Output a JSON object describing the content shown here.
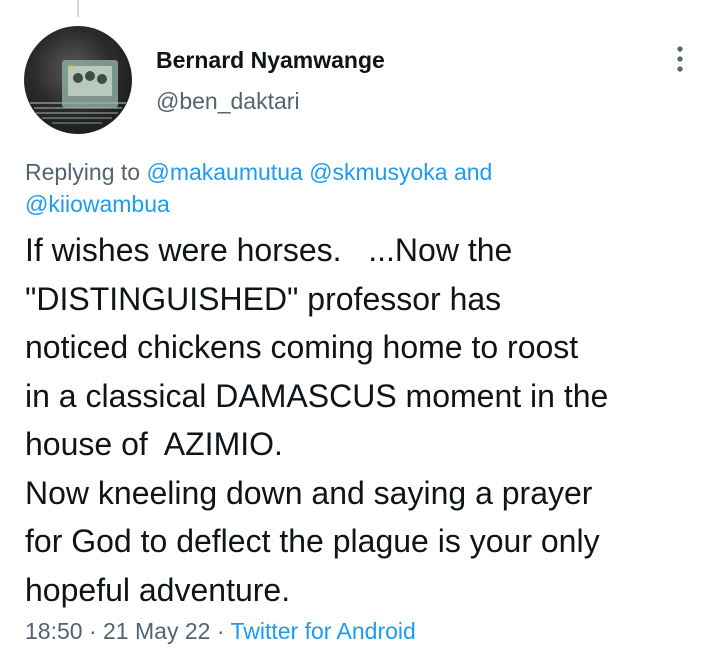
{
  "author": {
    "display_name": "Bernard Nyamwange",
    "handle": "@ben_daktari"
  },
  "reply": {
    "prefix": "Replying to",
    "mentions": [
      "@makaumutua",
      "@skmusyoka",
      "@kiiowambua"
    ],
    "and_word": "and"
  },
  "tweet": {
    "lines": [
      "If wishes were horses.   ...Now the",
      "\"DISTINGUISHED\" professor has",
      "noticed chickens coming home to roost",
      "in a classical DAMASCUS moment in the",
      "house of  AZIMIO.",
      "Now kneeling down and saying a prayer",
      "for God to deflect the plague is your only",
      "hopeful adventure."
    ]
  },
  "meta": {
    "time": "18:50",
    "separator": "·",
    "date": "21 May 22",
    "source": "Twitter for Android"
  },
  "colors": {
    "text": "#0f1419",
    "secondary": "#536471",
    "link": "#1d9bf0",
    "thread_line": "#cfd9de"
  },
  "icons": {
    "more": "vertical-ellipsis-icon"
  }
}
